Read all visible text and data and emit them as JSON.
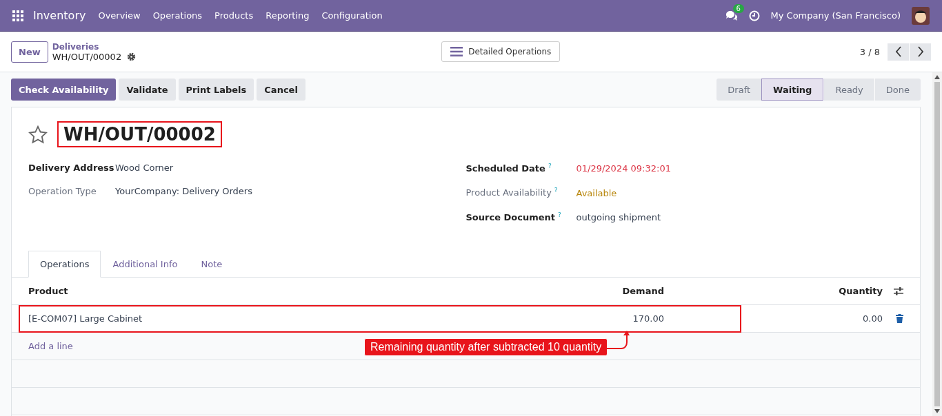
{
  "navbar": {
    "app": "Inventory",
    "menu": [
      "Overview",
      "Operations",
      "Products",
      "Reporting",
      "Configuration"
    ],
    "chat_badge": "6",
    "company": "My Company (San Francisco)"
  },
  "control_panel": {
    "new_button": "New",
    "breadcrumb": "Deliveries",
    "record": "WH/OUT/00002",
    "view_button": "Detailed Operations",
    "pager": "3 / 8"
  },
  "actions": [
    {
      "label": "Check Availability",
      "primary": true
    },
    {
      "label": "Validate",
      "primary": false
    },
    {
      "label": "Print Labels",
      "primary": false
    },
    {
      "label": "Cancel",
      "primary": false
    }
  ],
  "statusbar": [
    {
      "label": "Draft",
      "selected": false
    },
    {
      "label": "Waiting",
      "selected": true
    },
    {
      "label": "Ready",
      "selected": false
    },
    {
      "label": "Done",
      "selected": false
    }
  ],
  "title": {
    "text": "WH/OUT/00002",
    "starred": false
  },
  "fields_left": [
    {
      "label": "Delivery Address",
      "required": true,
      "value": "Wood Corner",
      "color": "#374151"
    },
    {
      "label": "Operation Type",
      "required": false,
      "value": "YourCompany: Delivery Orders",
      "color": "#374151"
    }
  ],
  "fields_right": [
    {
      "label": "Scheduled Date",
      "help": "?",
      "required": true,
      "value": "01/29/2024 09:32:01",
      "color": "#dc3545"
    },
    {
      "label": "Product Availability",
      "help": "?",
      "required": false,
      "value": "Available",
      "color": "#b8860b"
    },
    {
      "label": "Source Document",
      "help": "?",
      "required": true,
      "value": "outgoing shipment",
      "color": "#374151"
    }
  ],
  "tabs": [
    {
      "label": "Operations",
      "selected": true
    },
    {
      "label": "Additional Info",
      "selected": false
    },
    {
      "label": "Note",
      "selected": false
    }
  ],
  "table": {
    "columns": [
      "Product",
      "Demand",
      "Quantity"
    ],
    "rows": [
      {
        "product": "[E-COM07] Large Cabinet",
        "demand": "170.00",
        "quantity": "0.00"
      }
    ],
    "add_line": "Add a line"
  },
  "annotation": {
    "text": "Remaining quantity after subtracted 10 quantity"
  }
}
